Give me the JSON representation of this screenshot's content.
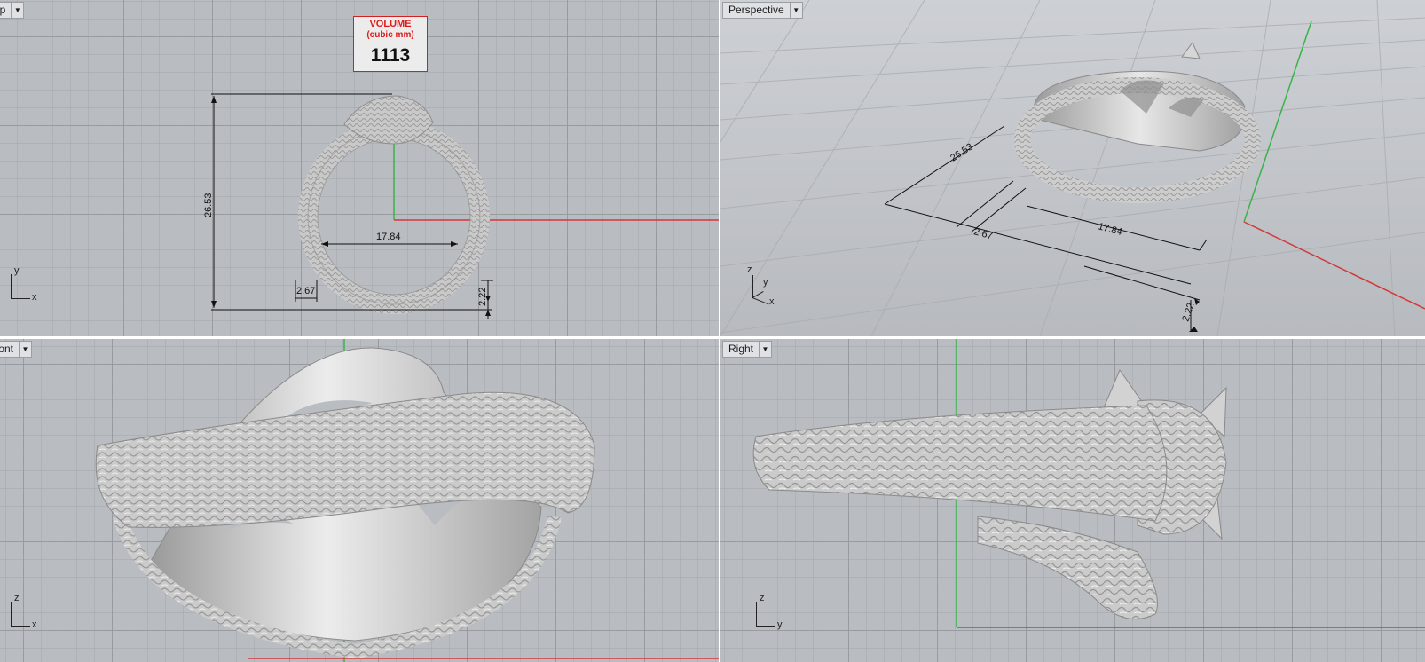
{
  "viewports": {
    "top": {
      "label": "Top",
      "axis_v": "y",
      "axis_h": "x"
    },
    "perspective": {
      "label": "Perspective",
      "axis_v": "z",
      "axis_y": "y",
      "axis_h": "x"
    },
    "front": {
      "label": "Front",
      "axis_v": "z",
      "axis_h": "x"
    },
    "right": {
      "label": "Right",
      "axis_v": "z",
      "axis_h": "y"
    }
  },
  "volume_box": {
    "title": "VOLUME",
    "unit": "(cubic mm)",
    "value": "1113"
  },
  "dimensions": {
    "height": "26.53",
    "inner_diameter": "17.84",
    "band_width": "2.67",
    "band_thickness": "2.22"
  },
  "colors": {
    "x_axis": "#d23a3a",
    "y_axis": "#39b34a",
    "volume_accent": "#e11919",
    "model": "#c6c6c6"
  }
}
